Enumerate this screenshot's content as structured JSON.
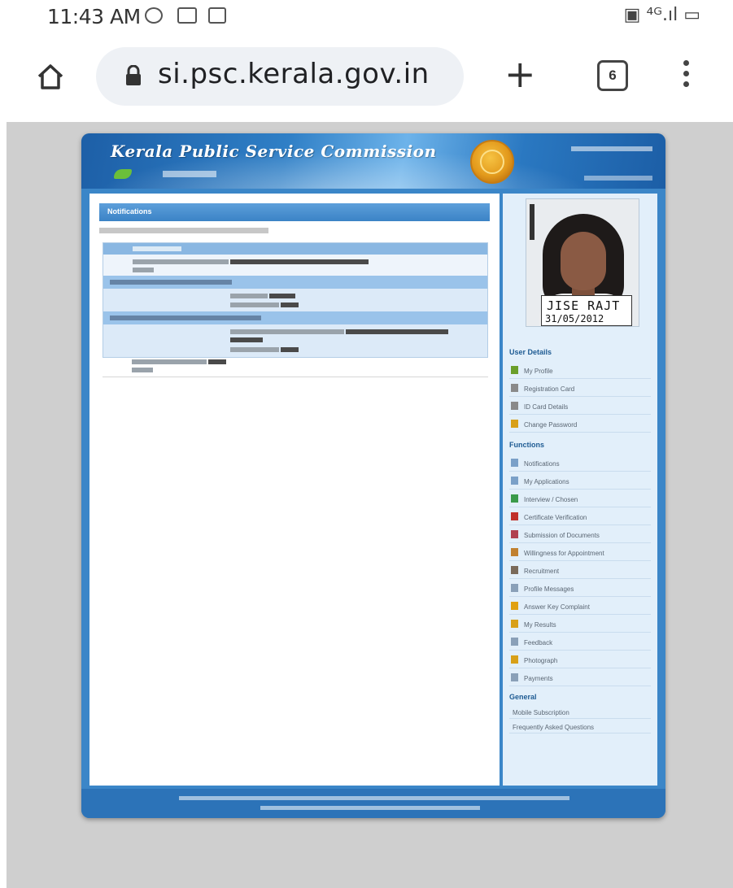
{
  "status_bar": {
    "time": "11:43 AM",
    "right_icons": "▣ ⁴ᴳ.ıl ▭"
  },
  "browser": {
    "url": "si.psc.kerala.gov.in",
    "new_tab_label": "+",
    "tab_count": "6"
  },
  "site": {
    "title": "Kerala Public Service Commission",
    "section_heading": "Notifications",
    "photo_name": "JISE RAJT",
    "photo_date": "31/05/2012"
  },
  "sidebar": {
    "user_details_heading": "User Details",
    "user_items": [
      {
        "label": "My Profile",
        "icon": "user-icon",
        "color": "#6a9e2a"
      },
      {
        "label": "Registration Card",
        "icon": "card-icon",
        "color": "#8a8a8a"
      },
      {
        "label": "ID Card Details",
        "icon": "id-card-icon",
        "color": "#8a8a8a"
      },
      {
        "label": "Change Password",
        "icon": "key-icon",
        "color": "#d8a018"
      }
    ],
    "functions_heading": "Functions",
    "function_items": [
      {
        "label": "Notifications",
        "icon": "notification-icon",
        "color": "#7aa0c8"
      },
      {
        "label": "My Applications",
        "icon": "applications-icon",
        "color": "#7aa0c8"
      },
      {
        "label": "Interview / Chosen",
        "icon": "interview-icon",
        "color": "#3a9a4a"
      },
      {
        "label": "Certificate Verification",
        "icon": "verification-icon",
        "color": "#c0302a"
      },
      {
        "label": "Submission of Documents",
        "icon": "documents-icon",
        "color": "#b04050"
      },
      {
        "label": "Willingness for Appointment",
        "icon": "appointment-icon",
        "color": "#c08030"
      },
      {
        "label": "Recruitment",
        "icon": "recruitment-icon",
        "color": "#7a6a5a"
      },
      {
        "label": "Profile Messages",
        "icon": "messages-icon",
        "color": "#8aa0b8"
      },
      {
        "label": "Answer Key Complaint",
        "icon": "answer-key-icon",
        "color": "#e0a010"
      },
      {
        "label": "My Results",
        "icon": "results-icon",
        "color": "#d8a018"
      },
      {
        "label": "Feedback",
        "icon": "feedback-icon",
        "color": "#8aa0b8"
      },
      {
        "label": "Photograph",
        "icon": "photograph-icon",
        "color": "#d8a018"
      },
      {
        "label": "Payments",
        "icon": "payments-icon",
        "color": "#8aa0b8"
      }
    ],
    "general_heading": "General",
    "general_items": [
      {
        "label": "Mobile Subscription"
      },
      {
        "label": "Frequently Asked Questions"
      }
    ]
  }
}
